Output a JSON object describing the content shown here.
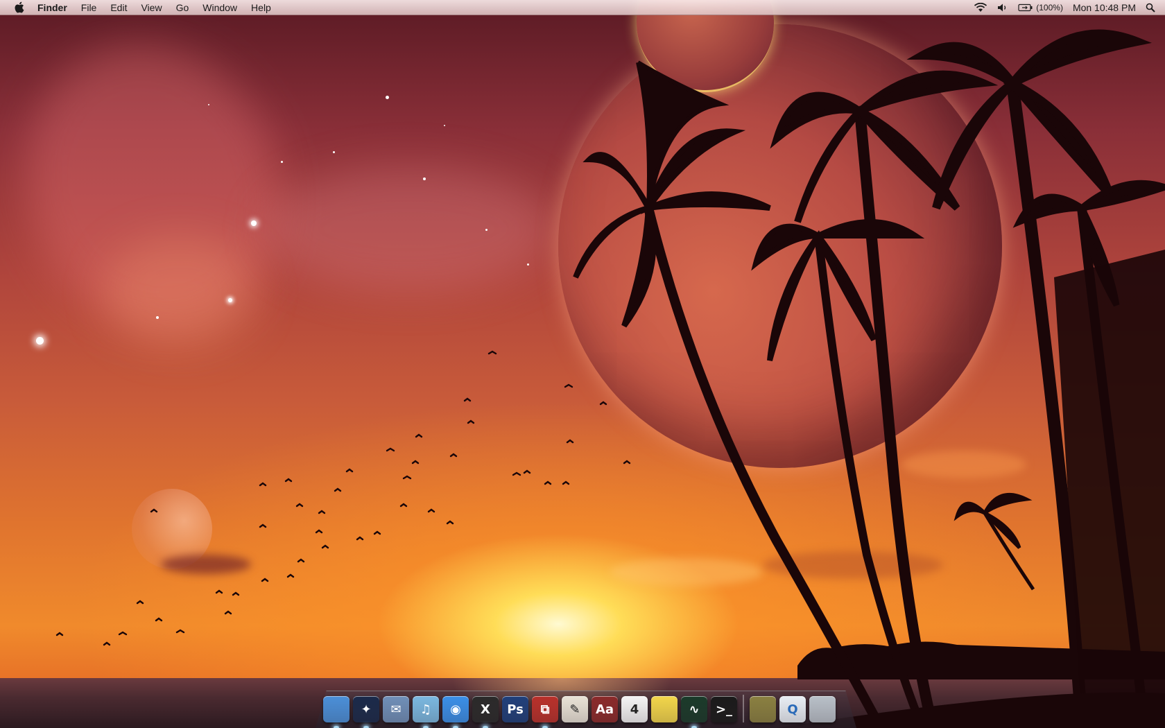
{
  "menubar": {
    "apple_icon": "apple-icon",
    "app_name": "Finder",
    "menus": [
      "File",
      "Edit",
      "View",
      "Go",
      "Window",
      "Help"
    ],
    "status": {
      "wifi_icon": "wifi-icon",
      "volume_icon": "volume-icon",
      "battery_icon": "battery-icon",
      "battery_text": "(100%)",
      "clock": "Mon 10:48 PM",
      "spotlight_icon": "spotlight-icon"
    }
  },
  "dock": {
    "items": [
      {
        "name": "finder-icon",
        "glyph": "",
        "color": "#4a8fd8",
        "running": true
      },
      {
        "name": "dashboard-icon",
        "glyph": "✦",
        "color": "#1a2a4a",
        "running": true
      },
      {
        "name": "mail-icon",
        "glyph": "✉",
        "color": "#6f8fb8",
        "running": false
      },
      {
        "name": "itunes-icon",
        "glyph": "♫",
        "color": "#7ab8e0",
        "running": true
      },
      {
        "name": "ichat-icon",
        "glyph": "◉",
        "color": "#3a8fe8",
        "running": true
      },
      {
        "name": "x11-chat-icon",
        "glyph": "X",
        "color": "#2a2a2a",
        "running": true
      },
      {
        "name": "photoshop-icon",
        "glyph": "Ps",
        "color": "#1f3f7a",
        "running": false
      },
      {
        "name": "parallels-icon",
        "glyph": "⧉",
        "color": "#b8302a",
        "running": true
      },
      {
        "name": "textedit-icon",
        "glyph": "✎",
        "color": "#e8e2d6",
        "running": false
      },
      {
        "name": "dictionary-icon",
        "glyph": "Aa",
        "color": "#8a2a2a",
        "running": false
      },
      {
        "name": "ical-icon",
        "glyph": "4",
        "color": "#f4f4f4",
        "running": false
      },
      {
        "name": "stickies-icon",
        "glyph": "",
        "color": "#f2d64a",
        "running": false
      },
      {
        "name": "activity-monitor-icon",
        "glyph": "∿",
        "color": "#1a3a2a",
        "running": true
      },
      {
        "name": "terminal-icon",
        "glyph": ">_",
        "color": "#1a1a1a",
        "running": false
      }
    ],
    "stack_items": [
      {
        "name": "downloads-stack-icon",
        "glyph": "",
        "color": "#8a8040"
      },
      {
        "name": "quicktime-movie-icon",
        "glyph": "Q",
        "color": "#e8eef4"
      },
      {
        "name": "trash-icon",
        "glyph": "",
        "color": "#b8c0c8"
      }
    ]
  }
}
